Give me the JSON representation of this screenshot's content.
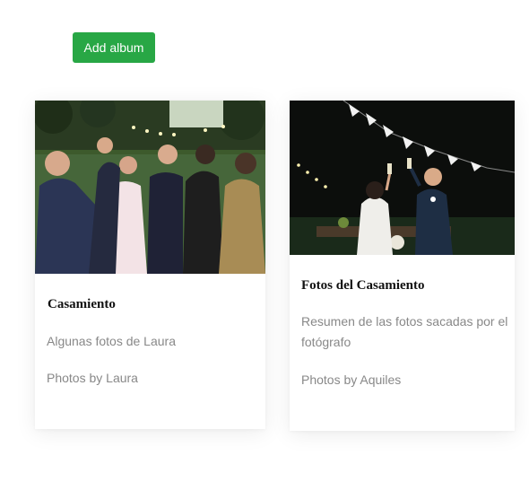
{
  "toolbar": {
    "add_album_label": "Add album"
  },
  "colors": {
    "primary_button": "#28a745",
    "title_text": "#111111",
    "muted_text": "#888888"
  },
  "albums": [
    {
      "title": "Casamiento",
      "description": "Algunas fotos de Laura",
      "author": "Photos by Laura",
      "cover": "wedding-guests-toast-photo"
    },
    {
      "title": "Fotos del Casamiento",
      "description": "Resumen de las fotos sacadas por el fotógrafo",
      "author": "Photos by Aquiles",
      "cover": "couple-toast-night-photo"
    }
  ]
}
